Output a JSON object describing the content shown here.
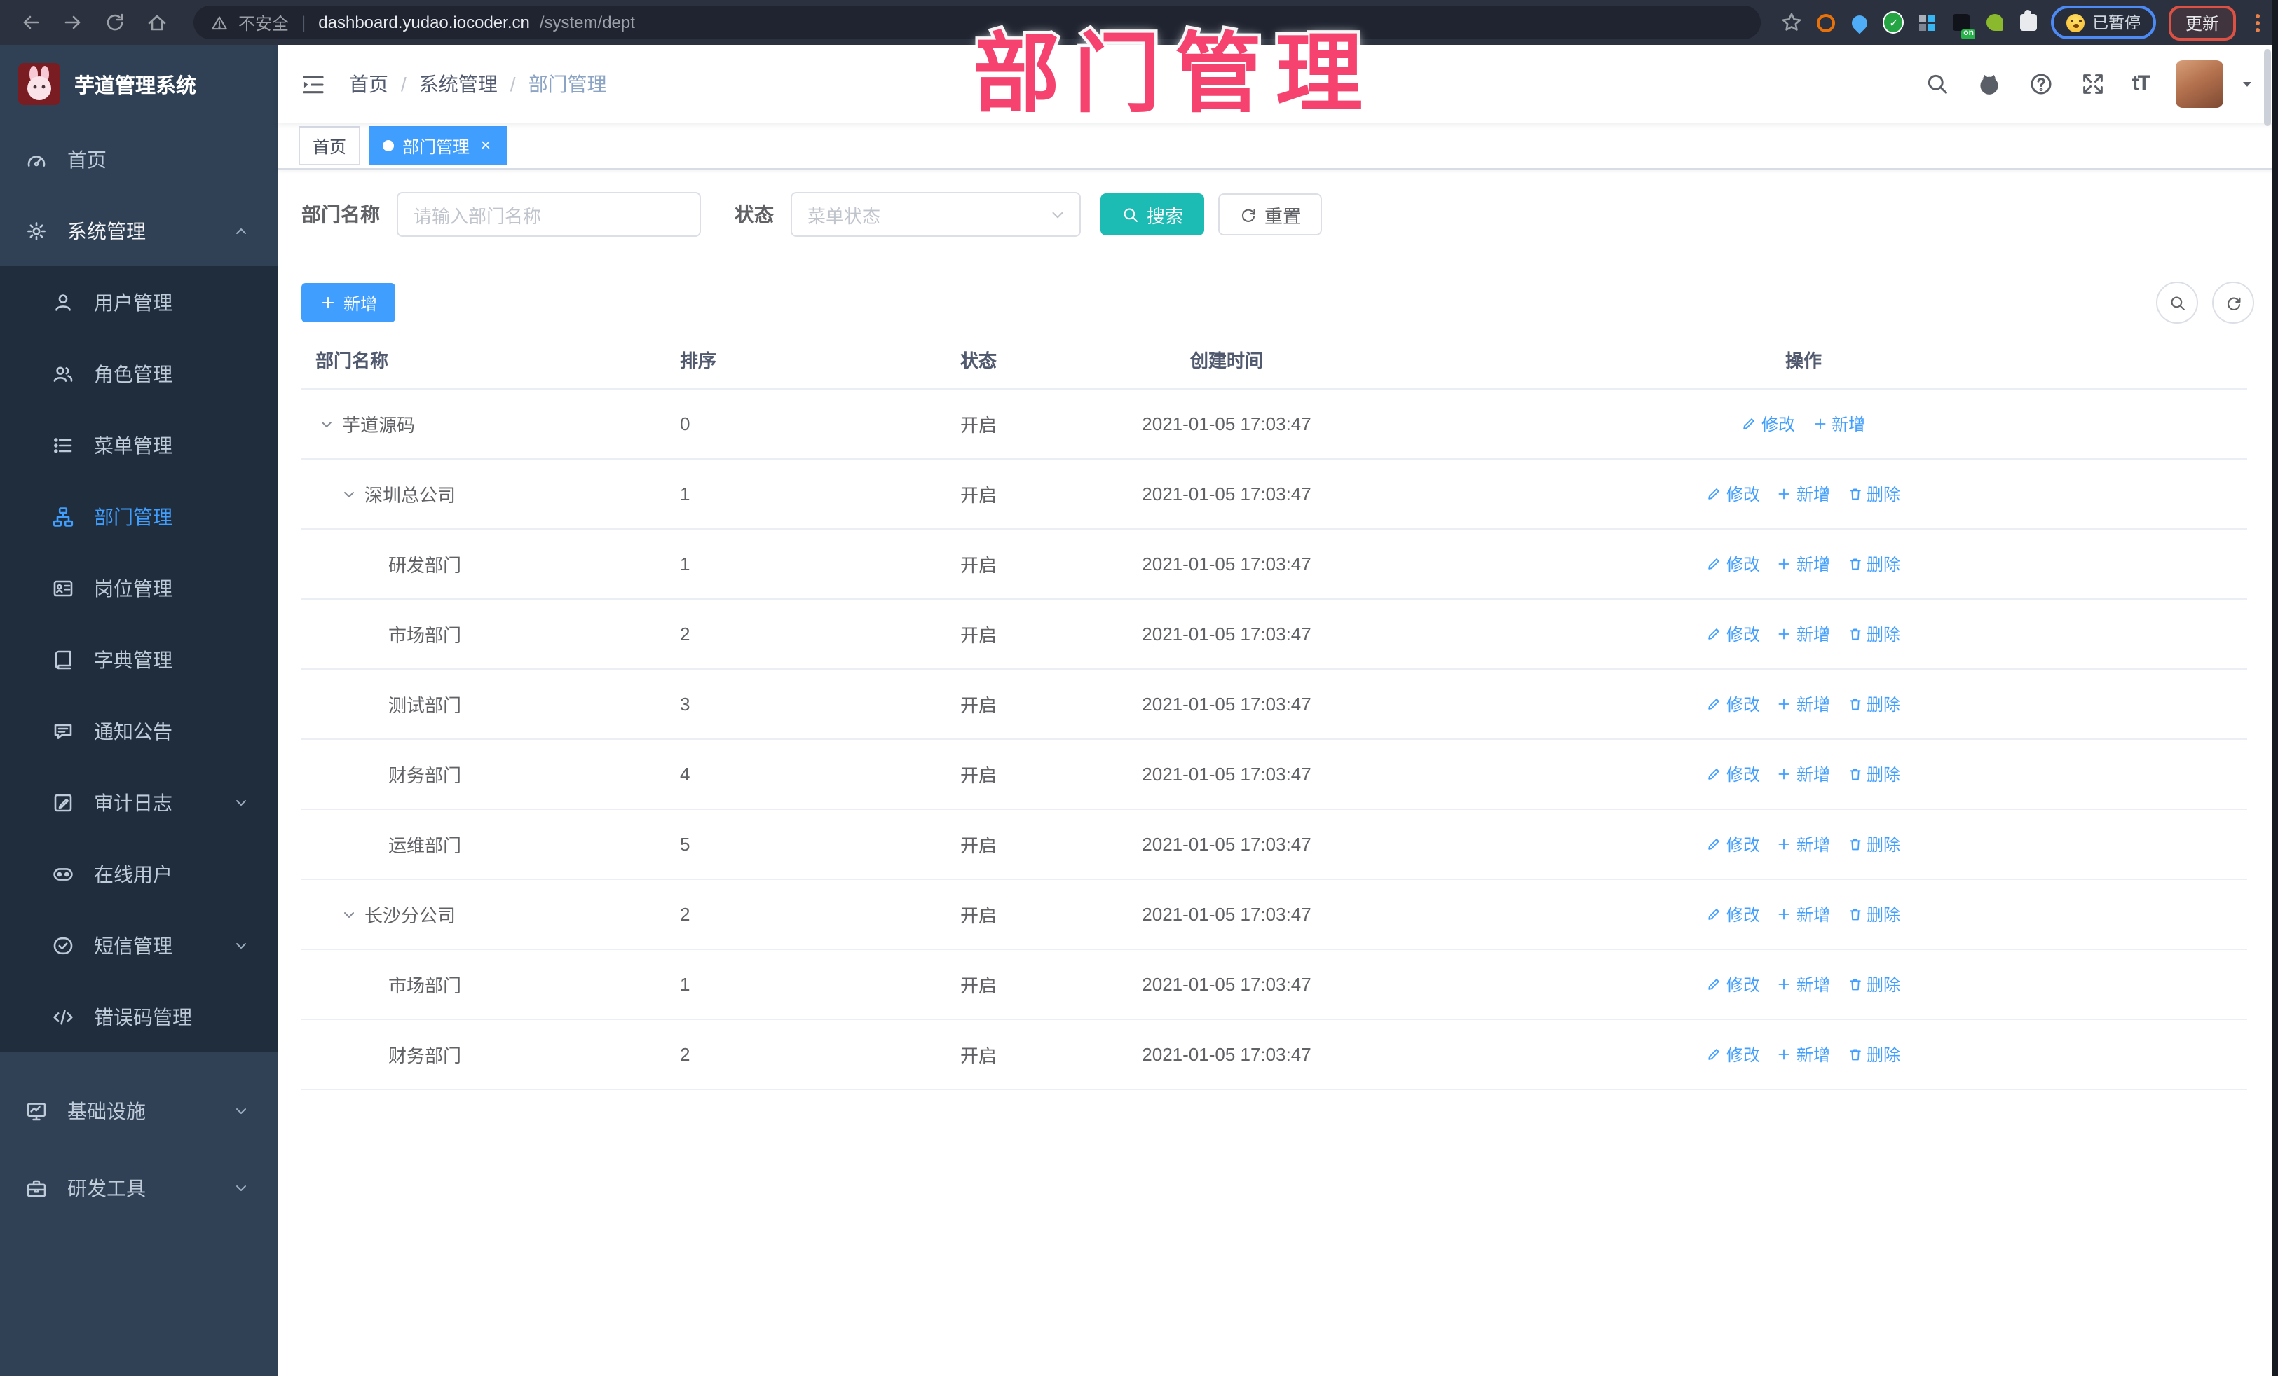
{
  "colors": {
    "accent": "#409eff",
    "search_teal": "#1cbbb4",
    "overlay_pink": "#f5426e",
    "sidebar_bg": "#304156",
    "submenu_bg": "#1f2d3d",
    "chrome_bg": "#2b313e"
  },
  "browser": {
    "security_label": "不安全",
    "url_host": "dashboard.yudao.iocoder.cn",
    "url_path": "/system/dept",
    "paused_label": "已暂停",
    "update_label": "更新",
    "on_badge": "on",
    "nav_icons": [
      "arrow-left-icon",
      "arrow-right-icon",
      "reload-icon",
      "home-icon"
    ],
    "extensions": [
      "ext-orange-icon",
      "ext-pin-icon",
      "ext-green-check-icon",
      "ext-grid-icon",
      "ext-on-icon",
      "ext-leaf-icon",
      "ext-puzzle-icon"
    ]
  },
  "overlay": {
    "title": "部门管理"
  },
  "sidebar": {
    "logo_title": "芋道管理系统",
    "items": [
      {
        "label": "首页",
        "icon": "dashboard-icon",
        "type": "item"
      },
      {
        "label": "系统管理",
        "icon": "gear-icon",
        "type": "group",
        "arrow": "up",
        "expanded": true,
        "children": [
          {
            "label": "用户管理",
            "icon": "user-icon"
          },
          {
            "label": "角色管理",
            "icon": "users-icon"
          },
          {
            "label": "菜单管理",
            "icon": "menu-list-icon"
          },
          {
            "label": "部门管理",
            "icon": "org-tree-icon",
            "active": true
          },
          {
            "label": "岗位管理",
            "icon": "id-badge-icon"
          },
          {
            "label": "字典管理",
            "icon": "book-icon"
          },
          {
            "label": "通知公告",
            "icon": "megaphone-icon"
          },
          {
            "label": "审计日志",
            "icon": "log-icon",
            "arrow": "down"
          },
          {
            "label": "在线用户",
            "icon": "online-users-icon"
          },
          {
            "label": "短信管理",
            "icon": "sms-icon",
            "arrow": "down"
          },
          {
            "label": "错误码管理",
            "icon": "code-icon"
          }
        ]
      },
      {
        "label": "基础设施",
        "icon": "infra-icon",
        "type": "group",
        "arrow": "down",
        "bottom": true
      },
      {
        "label": "研发工具",
        "icon": "toolbox-icon",
        "type": "group",
        "arrow": "down",
        "bottom": true
      }
    ]
  },
  "navbar": {
    "breadcrumb": [
      "首页",
      "系统管理",
      "部门管理"
    ],
    "right_icons": [
      "search-icon",
      "github-icon",
      "question-icon",
      "fullscreen-icon",
      "font-size-icon"
    ]
  },
  "tags": [
    {
      "label": "首页",
      "active": false
    },
    {
      "label": "部门管理",
      "active": true
    }
  ],
  "filter": {
    "name_label": "部门名称",
    "name_placeholder": "请输入部门名称",
    "status_label": "状态",
    "status_placeholder": "菜单状态",
    "search_label": "搜索",
    "reset_label": "重置"
  },
  "toolbar": {
    "add_label": "新增"
  },
  "table": {
    "columns": [
      "部门名称",
      "排序",
      "状态",
      "创建时间",
      "操作"
    ],
    "action_labels": {
      "edit": "修改",
      "add": "新增",
      "delete": "删除"
    },
    "rows": [
      {
        "name": "芋道源码",
        "level": 0,
        "caret": true,
        "sort": "0",
        "status": "开启",
        "time": "2021-01-05 17:03:47",
        "actions": [
          "edit",
          "add"
        ]
      },
      {
        "name": "深圳总公司",
        "level": 1,
        "caret": true,
        "sort": "1",
        "status": "开启",
        "time": "2021-01-05 17:03:47",
        "actions": [
          "edit",
          "add",
          "delete"
        ]
      },
      {
        "name": "研发部门",
        "level": 2,
        "caret": false,
        "sort": "1",
        "status": "开启",
        "time": "2021-01-05 17:03:47",
        "actions": [
          "edit",
          "add",
          "delete"
        ]
      },
      {
        "name": "市场部门",
        "level": 2,
        "caret": false,
        "sort": "2",
        "status": "开启",
        "time": "2021-01-05 17:03:47",
        "actions": [
          "edit",
          "add",
          "delete"
        ]
      },
      {
        "name": "测试部门",
        "level": 2,
        "caret": false,
        "sort": "3",
        "status": "开启",
        "time": "2021-01-05 17:03:47",
        "actions": [
          "edit",
          "add",
          "delete"
        ]
      },
      {
        "name": "财务部门",
        "level": 2,
        "caret": false,
        "sort": "4",
        "status": "开启",
        "time": "2021-01-05 17:03:47",
        "actions": [
          "edit",
          "add",
          "delete"
        ]
      },
      {
        "name": "运维部门",
        "level": 2,
        "caret": false,
        "sort": "5",
        "status": "开启",
        "time": "2021-01-05 17:03:47",
        "actions": [
          "edit",
          "add",
          "delete"
        ]
      },
      {
        "name": "长沙分公司",
        "level": 1,
        "caret": true,
        "sort": "2",
        "status": "开启",
        "time": "2021-01-05 17:03:47",
        "actions": [
          "edit",
          "add",
          "delete"
        ]
      },
      {
        "name": "市场部门",
        "level": 2,
        "caret": false,
        "sort": "1",
        "status": "开启",
        "time": "2021-01-05 17:03:47",
        "actions": [
          "edit",
          "add",
          "delete"
        ]
      },
      {
        "name": "财务部门",
        "level": 2,
        "caret": false,
        "sort": "2",
        "status": "开启",
        "time": "2021-01-05 17:03:47",
        "actions": [
          "edit",
          "add",
          "delete"
        ]
      }
    ]
  }
}
